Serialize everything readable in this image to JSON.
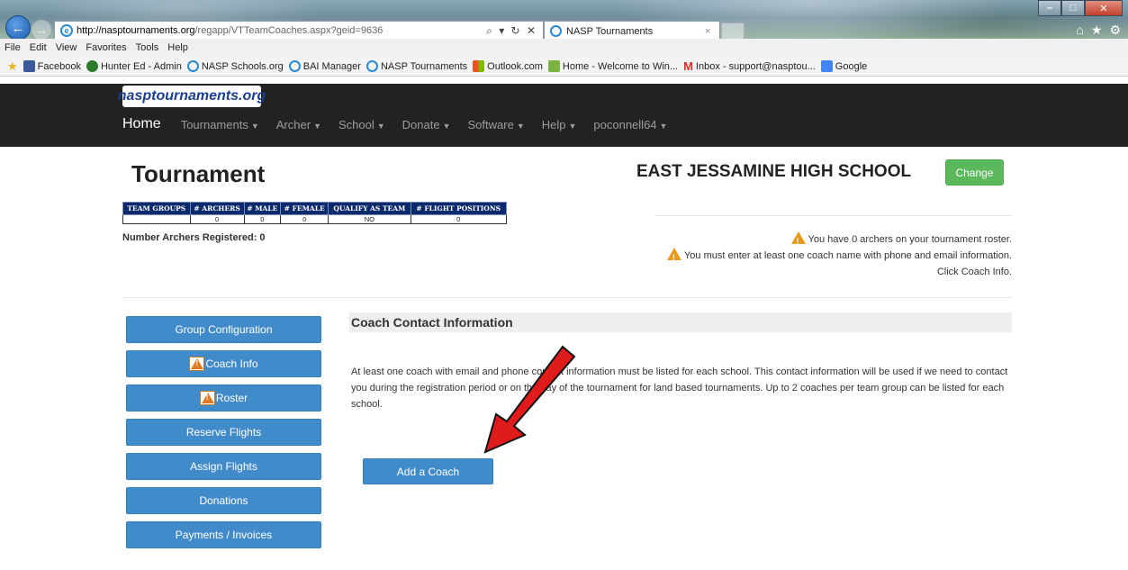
{
  "browser": {
    "url_main": "http://nasptournaments.org",
    "url_path": "/regapp/VTTeamCoaches.aspx?geid=9636",
    "address_controls": "⌕ ▾ ↻ ✕",
    "tab_title": "NASP Tournaments",
    "tab_close": "×",
    "menu": [
      "File",
      "Edit",
      "View",
      "Favorites",
      "Tools",
      "Help"
    ],
    "favorites": [
      {
        "label": "Facebook",
        "icon": "facebook-icon",
        "color": "#3b5998"
      },
      {
        "label": "Hunter Ed - Admin",
        "icon": "globe-icon",
        "color": "#2a7a2a"
      },
      {
        "label": "NASP Schools.org",
        "icon": "ie-page-icon",
        "color": "#2a8ad6"
      },
      {
        "label": "BAI Manager",
        "icon": "ie-page-icon",
        "color": "#2a8ad6"
      },
      {
        "label": "NASP Tournaments",
        "icon": "ie-page-icon",
        "color": "#2a8ad6"
      },
      {
        "label": "Outlook.com",
        "icon": "windows-icon",
        "color": "#e8a317"
      },
      {
        "label": "Home - Welcome to Win...",
        "icon": "page-icon",
        "color": "#7cb342"
      },
      {
        "label": "Inbox - support@nasptou...",
        "icon": "gmail-icon",
        "color": "#d93025"
      },
      {
        "label": "Google",
        "icon": "google-icon",
        "color": "#4285f4"
      }
    ]
  },
  "site": {
    "logo": "nasptournaments.org",
    "nav": [
      {
        "label": "Home",
        "caret": false
      },
      {
        "label": "Tournaments",
        "caret": true
      },
      {
        "label": "Archer",
        "caret": true
      },
      {
        "label": "School",
        "caret": true
      },
      {
        "label": "Donate",
        "caret": true
      },
      {
        "label": "Software",
        "caret": true
      },
      {
        "label": "Help",
        "caret": true
      },
      {
        "label": "poconnell64",
        "caret": true
      }
    ]
  },
  "page": {
    "title": "Tournament",
    "school_name": "EAST JESSAMINE HIGH SCHOOL",
    "change_label": "Change",
    "stats": {
      "headers": [
        "TEAM GROUPS",
        "# ARCHERS",
        "# MALE",
        "# FEMALE",
        "QUALIFY AS TEAM",
        "# FLIGHT POSITIONS"
      ],
      "row": [
        "",
        "0",
        "0",
        "0",
        "NO",
        "0"
      ]
    },
    "num_archers_label": "Number Archers Registered: 0",
    "warnings": [
      "You have 0 archers on your tournament roster.",
      "You must enter at least one coach name with phone and email information. Click Coach Info."
    ],
    "sidebar": [
      {
        "label": "Group Configuration",
        "warn": false
      },
      {
        "label": "Coach Info",
        "warn": true
      },
      {
        "label": "Roster",
        "warn": true
      },
      {
        "label": "Reserve Flights",
        "warn": false
      },
      {
        "label": "Assign Flights",
        "warn": false
      },
      {
        "label": "Donations",
        "warn": false
      },
      {
        "label": "Payments / Invoices",
        "warn": false
      }
    ],
    "section_title": "Coach Contact Information",
    "section_text": "At least one coach with email and phone contact information must be listed for each school. This contact information will be used if we need to contact you during the registration period or on the day of the tournament for land based tournaments. Up to 2 coaches per team group can be listed for each school.",
    "add_coach_label": "Add a Coach"
  },
  "colors": {
    "nav_bg": "#222222",
    "primary_btn": "#428bca",
    "success_btn": "#5cb85c",
    "table_header": "#0b2a6e",
    "annotation_arrow": "#e01b1b"
  }
}
